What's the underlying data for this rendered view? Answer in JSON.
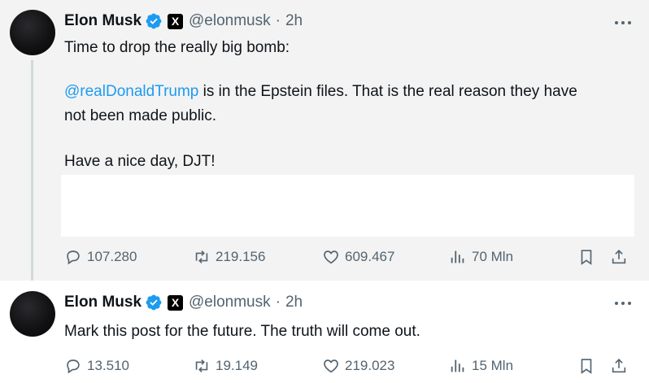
{
  "tweets": [
    {
      "author_name": "Elon Musk",
      "handle": "@elonmusk",
      "separator": "·",
      "time": "2h",
      "badge": "X",
      "text_line1": "Time to drop the really big bomb:",
      "mention": "@realDonaldTrump",
      "text_line2_rest": " is in the Epstein files. That is the real reason they have",
      "text_line3": "not been made public.",
      "text_line4": "Have a nice day, DJT!",
      "stats": {
        "replies": "107.280",
        "reposts": "219.156",
        "likes": "609.467",
        "views": "70 Mln"
      }
    },
    {
      "author_name": "Elon Musk",
      "handle": "@elonmusk",
      "separator": "·",
      "time": "2h",
      "badge": "X",
      "text": "Mark this post for the future. The truth will come out.",
      "stats": {
        "replies": "13.510",
        "reposts": "19.149",
        "likes": "219.023",
        "views": "15 Mln"
      }
    }
  ],
  "colors": {
    "accent": "#1d9bf0",
    "muted": "#536471",
    "text": "#0f1419",
    "verified": "#1d9bf0"
  },
  "icons": [
    "verified-badge-icon",
    "x-logo-icon",
    "more-icon",
    "reply-icon",
    "repost-icon",
    "like-icon",
    "views-icon",
    "bookmark-icon",
    "share-icon"
  ]
}
